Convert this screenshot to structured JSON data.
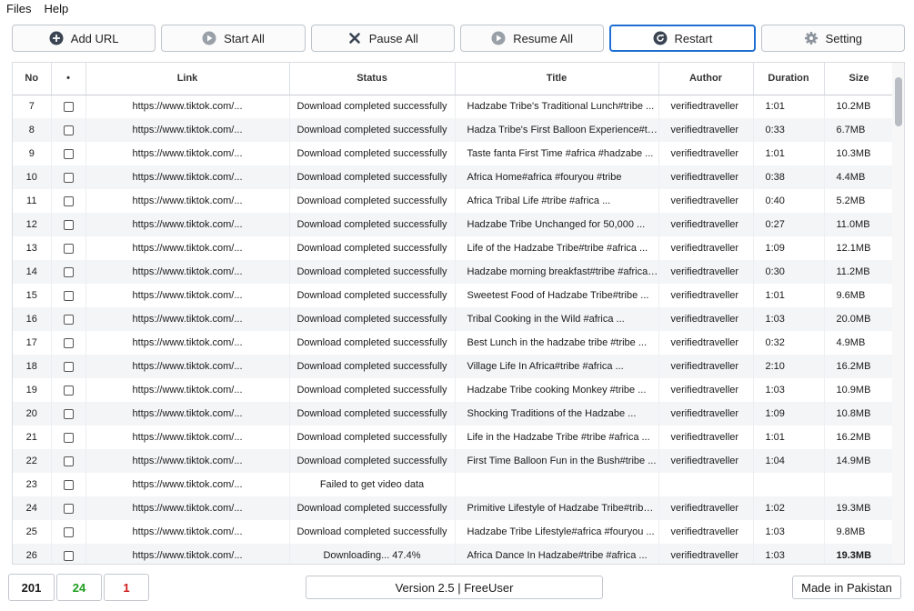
{
  "menu": {
    "files": "Files",
    "help": "Help"
  },
  "toolbar": {
    "add_url": "Add URL",
    "start_all": "Start All",
    "pause_all": "Pause All",
    "resume_all": "Resume All",
    "restart": "Restart",
    "setting": "Setting",
    "icons": {
      "add_url": "plus-circle-icon",
      "start_all": "play-icon",
      "pause_all": "x-icon",
      "resume_all": "play-icon",
      "restart": "refresh-icon",
      "setting": "gear-icon"
    },
    "accent_color": "#1f6fd1"
  },
  "table": {
    "columns": [
      "No",
      "•",
      "Link",
      "Status",
      "Title",
      "Author",
      "Duration",
      "Size"
    ],
    "rows": [
      {
        "no": "7",
        "link": "https://www.tiktok.com/...",
        "status": "Download completed successfully",
        "title": "Hadzabe Tribe's Traditional Lunch#tribe ...",
        "author": "verifiedtraveller",
        "duration": "1:01",
        "size": "10.2MB"
      },
      {
        "no": "8",
        "link": "https://www.tiktok.com/...",
        "status": "Download completed successfully",
        "title": "Hadza Tribe's First Balloon Experience#tri...",
        "author": "verifiedtraveller",
        "duration": "0:33",
        "size": "6.7MB"
      },
      {
        "no": "9",
        "link": "https://www.tiktok.com/...",
        "status": "Download completed successfully",
        "title": "Taste fanta First Time  #africa #hadzabe ...",
        "author": "verifiedtraveller",
        "duration": "1:01",
        "size": "10.3MB"
      },
      {
        "no": "10",
        "link": "https://www.tiktok.com/...",
        "status": "Download completed successfully",
        "title": "Africa Home#africa #fouryou #tribe",
        "author": "verifiedtraveller",
        "duration": "0:38",
        "size": "4.4MB"
      },
      {
        "no": "11",
        "link": "https://www.tiktok.com/...",
        "status": "Download completed successfully",
        "title": "Africa Tribal Life #tribe #africa ...",
        "author": "verifiedtraveller",
        "duration": "0:40",
        "size": "5.2MB"
      },
      {
        "no": "12",
        "link": "https://www.tiktok.com/...",
        "status": "Download completed successfully",
        "title": "Hadzabe Tribe Unchanged for 50,000 ...",
        "author": "verifiedtraveller",
        "duration": "0:27",
        "size": "11.0MB"
      },
      {
        "no": "13",
        "link": "https://www.tiktok.com/...",
        "status": "Download completed successfully",
        "title": "Life of the Hadzabe Tribe#tribe #africa ...",
        "author": "verifiedtraveller",
        "duration": "1:09",
        "size": "12.1MB"
      },
      {
        "no": "14",
        "link": "https://www.tiktok.com/...",
        "status": "Download completed successfully",
        "title": "Hadzabe morning breakfast#tribe #africa ...",
        "author": "verifiedtraveller",
        "duration": "0:30",
        "size": "11.2MB"
      },
      {
        "no": "15",
        "link": "https://www.tiktok.com/...",
        "status": "Download completed successfully",
        "title": "Sweetest Food of Hadzabe Tribe#tribe ...",
        "author": "verifiedtraveller",
        "duration": "1:01",
        "size": "9.6MB"
      },
      {
        "no": "16",
        "link": "https://www.tiktok.com/...",
        "status": "Download completed successfully",
        "title": "Tribal Cooking in the Wild  #africa ...",
        "author": "verifiedtraveller",
        "duration": "1:03",
        "size": "20.0MB"
      },
      {
        "no": "17",
        "link": "https://www.tiktok.com/...",
        "status": "Download completed successfully",
        "title": "Best Lunch in the hadzabe tribe #tribe ...",
        "author": "verifiedtraveller",
        "duration": "0:32",
        "size": "4.9MB"
      },
      {
        "no": "18",
        "link": "https://www.tiktok.com/...",
        "status": "Download completed successfully",
        "title": "Village Life In Africa#tribe #africa ...",
        "author": "verifiedtraveller",
        "duration": "2:10",
        "size": "16.2MB"
      },
      {
        "no": "19",
        "link": "https://www.tiktok.com/...",
        "status": "Download completed successfully",
        "title": "Hadzabe Tribe cooking Monkey #tribe ...",
        "author": "verifiedtraveller",
        "duration": "1:03",
        "size": "10.9MB"
      },
      {
        "no": "20",
        "link": "https://www.tiktok.com/...",
        "status": "Download completed successfully",
        "title": "Shocking Traditions of the Hadzabe ...",
        "author": "verifiedtraveller",
        "duration": "1:09",
        "size": "10.8MB"
      },
      {
        "no": "21",
        "link": "https://www.tiktok.com/...",
        "status": "Download completed successfully",
        "title": "Life in the Hadzabe Tribe #tribe #africa ...",
        "author": "verifiedtraveller",
        "duration": "1:01",
        "size": "16.2MB"
      },
      {
        "no": "22",
        "link": "https://www.tiktok.com/...",
        "status": "Download completed successfully",
        "title": "First Time Balloon Fun in the Bush#tribe ...",
        "author": "verifiedtraveller",
        "duration": "1:04",
        "size": "14.9MB"
      },
      {
        "no": "23",
        "link": "https://www.tiktok.com/...",
        "status": "Failed to get video data",
        "title": "",
        "author": "",
        "duration": "",
        "size": ""
      },
      {
        "no": "24",
        "link": "https://www.tiktok.com/...",
        "status": "Download completed successfully",
        "title": "Primitive Lifestyle of Hadzabe Tribe#tribe ...",
        "author": "verifiedtraveller",
        "duration": "1:02",
        "size": "19.3MB"
      },
      {
        "no": "25",
        "link": "https://www.tiktok.com/...",
        "status": "Download completed successfully",
        "title": "Hadzabe Tribe Lifestyle#africa #fouryou ...",
        "author": "verifiedtraveller",
        "duration": "1:03",
        "size": "9.8MB"
      },
      {
        "no": "26",
        "link": "https://www.tiktok.com/...",
        "status": "Downloading... 47.4%",
        "title": "Africa Dance In Hadzabe#tribe #africa ...",
        "author": "verifiedtraveller",
        "duration": "1:03",
        "size": "19.3MB",
        "size_bold": true
      }
    ]
  },
  "status_bar": {
    "total": "201",
    "success": "24",
    "failed": "1",
    "success_color": "#1e9e1e",
    "failed_color": "#d11a1a",
    "version": "Version 2.5 | FreeUser",
    "made_in": "Made in Pakistan"
  }
}
